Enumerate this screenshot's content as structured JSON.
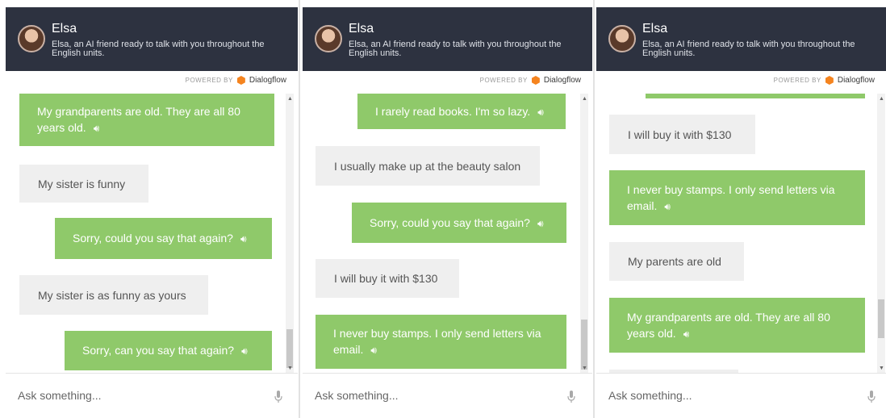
{
  "header": {
    "name": "Elsa",
    "description": "Elsa, an AI friend ready to talk with you throughout the English units."
  },
  "powered_by": {
    "label": "POWERED BY",
    "brand": "Dialogflow",
    "brand_color": "#f5841f"
  },
  "input": {
    "placeholder": "Ask something..."
  },
  "colors": {
    "header_bg": "#2d3240",
    "bot_bubble": "#8fc96a",
    "user_bubble": "#efefef"
  },
  "icons": {
    "speaker": "speaker-icon",
    "mic": "mic-icon",
    "logo": "dialogflow-logo-icon"
  },
  "panels": [
    {
      "messages": [
        {
          "from": "bot",
          "text": "My grandparents are old. They are all 80 years old."
        },
        {
          "from": "user",
          "text": "My sister is funny"
        },
        {
          "from": "bot",
          "text": "Sorry, could you say that again?"
        },
        {
          "from": "user",
          "text": "My sister is as funny as yours"
        },
        {
          "from": "bot",
          "text": "Sorry, can you say that again?"
        }
      ]
    },
    {
      "messages": [
        {
          "from": "bot",
          "text": "I rarely read books. I'm so lazy."
        },
        {
          "from": "user",
          "text": "I usually make up at the beauty salon"
        },
        {
          "from": "bot",
          "text": "Sorry, could you say that again?"
        },
        {
          "from": "user",
          "text": "I will buy it with $130"
        },
        {
          "from": "bot",
          "text": "I never buy stamps. I only send letters via email."
        }
      ]
    },
    {
      "messages": [
        {
          "from": "bot",
          "text": ""
        },
        {
          "from": "user",
          "text": "I will buy it with $130"
        },
        {
          "from": "bot",
          "text": "I never buy stamps. I only send letters via email."
        },
        {
          "from": "user",
          "text": "My parents are old"
        },
        {
          "from": "bot",
          "text": "My grandparents are old. They are all 80 years old."
        },
        {
          "from": "user",
          "text": ""
        }
      ]
    }
  ]
}
